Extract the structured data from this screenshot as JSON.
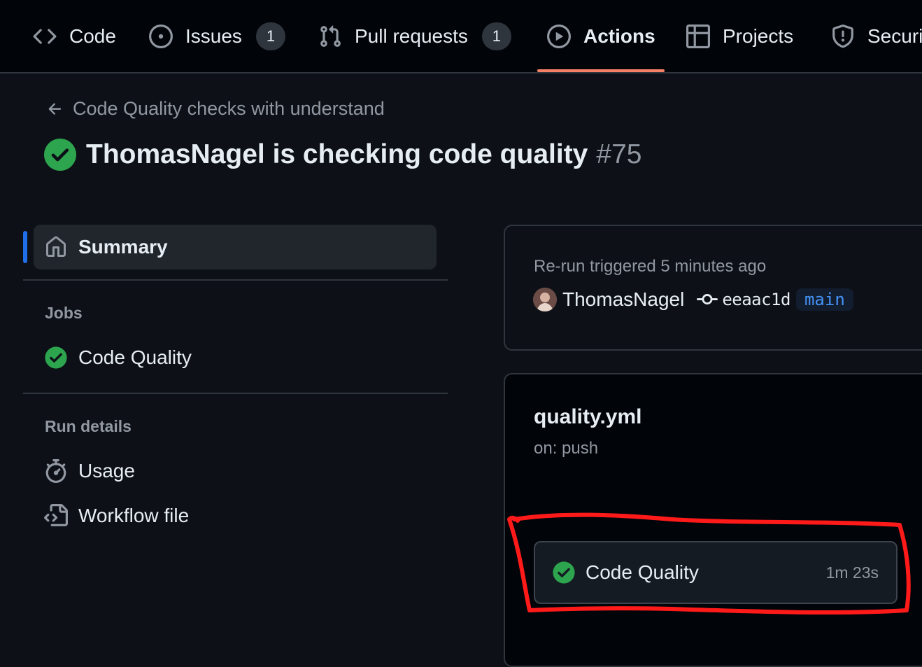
{
  "nav": {
    "tabs": [
      {
        "label": "Code",
        "icon": "code-icon"
      },
      {
        "label": "Issues",
        "icon": "issue-opened-icon",
        "count": "1"
      },
      {
        "label": "Pull requests",
        "icon": "git-pull-request-icon",
        "count": "1"
      },
      {
        "label": "Actions",
        "icon": "play-icon",
        "active": true
      },
      {
        "label": "Projects",
        "icon": "table-icon"
      },
      {
        "label": "Security",
        "icon": "shield-icon"
      }
    ]
  },
  "header": {
    "back_label": "Code Quality checks with understand",
    "title": "ThomasNagel is checking code quality",
    "run_number": "#75"
  },
  "sidebar": {
    "summary_label": "Summary",
    "jobs_heading": "Jobs",
    "jobs": [
      {
        "label": "Code Quality",
        "status": "success"
      }
    ],
    "run_details_heading": "Run details",
    "run_details": [
      {
        "label": "Usage",
        "icon": "stopwatch-icon"
      },
      {
        "label": "Workflow file",
        "icon": "file-code-icon"
      }
    ]
  },
  "run_info": {
    "trigger_text": "Re-run triggered 5 minutes ago",
    "user": "ThomasNagel",
    "commit_sha": "eeaac1d",
    "branch": "main"
  },
  "workflow": {
    "file_name": "quality.yml",
    "trigger": "on: push",
    "job_label": "Code Quality",
    "job_duration": "1m 23s"
  },
  "colors": {
    "background": "#0d1117",
    "nav_background": "#010409",
    "success": "#2da44e",
    "accent_underline": "#f78166",
    "link_blue": "#4493f8",
    "annotation_red": "#ff1a1a"
  }
}
